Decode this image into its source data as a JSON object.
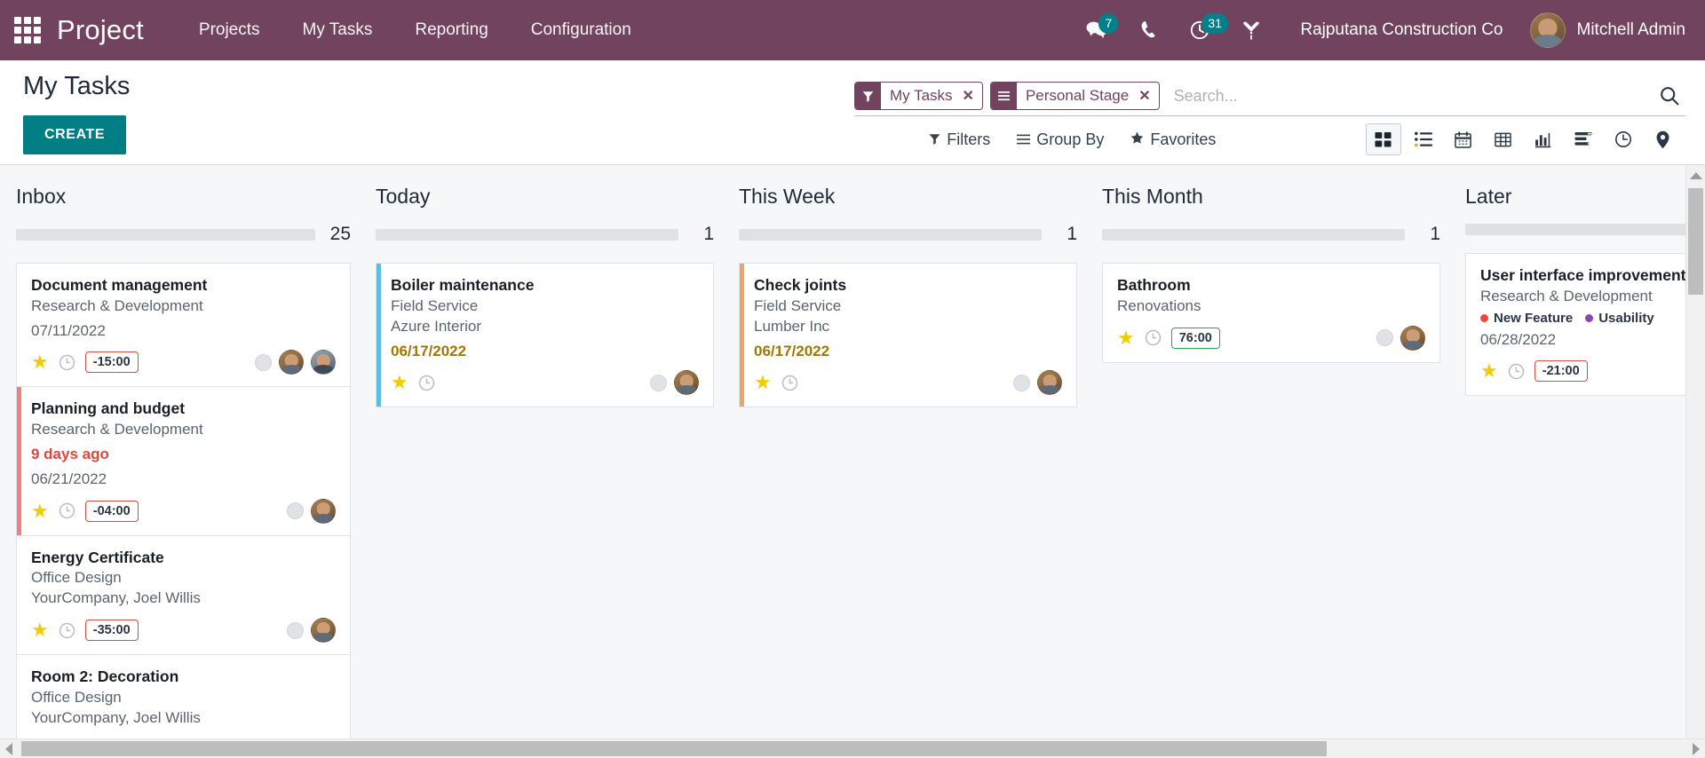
{
  "navbar": {
    "apps_icon": "apps-grid-icon",
    "brand": "Project",
    "menu": [
      {
        "label": "Projects"
      },
      {
        "label": "My Tasks"
      },
      {
        "label": "Reporting"
      },
      {
        "label": "Configuration"
      }
    ],
    "systray": {
      "messages_icon": "messages-icon",
      "messages_count": "7",
      "phone_icon": "phone-icon",
      "activities_icon": "activity-clock-icon",
      "activities_count": "31",
      "debug_icon": "wrench-tools-icon"
    },
    "company": "Rajputana Construction Co",
    "user": "Mitchell Admin",
    "accent_color": "#71435f",
    "badge_color": "#00808a"
  },
  "control_panel": {
    "title": "My Tasks",
    "create_label": "CREATE",
    "create_color": "#017e84",
    "search": {
      "placeholder": "Search...",
      "value": "",
      "facets": [
        {
          "icon": "filter-funnel-icon",
          "label": "My Tasks",
          "close": "✕"
        },
        {
          "icon": "group-by-list-icon",
          "label": "Personal Stage",
          "close": "✕"
        }
      ],
      "search_icon": "search-magnifier-icon"
    },
    "dropdowns": [
      {
        "icon": "filter-funnel-icon",
        "label": "Filters"
      },
      {
        "icon": "group-by-list-icon",
        "label": "Group By"
      },
      {
        "icon": "star-icon",
        "label": "Favorites"
      }
    ],
    "views": [
      {
        "name": "kanban-view",
        "active": true
      },
      {
        "name": "list-view",
        "active": false
      },
      {
        "name": "calendar-view",
        "active": false
      },
      {
        "name": "pivot-view",
        "active": false
      },
      {
        "name": "graph-view",
        "active": false
      },
      {
        "name": "gantt-view",
        "active": false
      },
      {
        "name": "activity-view",
        "active": false
      },
      {
        "name": "map-view",
        "active": false
      }
    ]
  },
  "kanban": {
    "columns": [
      {
        "title": "Inbox",
        "count": "25",
        "progress": [
          {
            "color": "#28a745",
            "percent": 8
          }
        ],
        "cards": [
          {
            "title": "Document management",
            "project": "Research & Development",
            "customer": "",
            "tags": [],
            "relative_date": "",
            "date": "07/11/2022",
            "date_state": "normal",
            "star": "★",
            "clock_icon": "clock-icon",
            "time_badge": "-15:00",
            "time_state": "negative",
            "circle": "status-circle",
            "avatars": [
              "brown",
              "gray"
            ],
            "stripe": ""
          },
          {
            "title": "Planning and budget",
            "project": "Research & Development",
            "customer": "",
            "tags": [],
            "relative_date": "9 days ago",
            "date": "06/21/2022",
            "date_state": "overdue",
            "star": "★",
            "clock_icon": "clock-icon",
            "time_badge": "-04:00",
            "time_state": "negative",
            "circle": "status-circle",
            "avatars": [
              "brown"
            ],
            "stripe": "#f08080"
          },
          {
            "title": "Energy Certificate",
            "project": "Office Design",
            "customer": "YourCompany, Joel Willis",
            "tags": [],
            "relative_date": "",
            "date": "",
            "date_state": "normal",
            "star": "★",
            "clock_icon": "clock-icon",
            "time_badge": "-35:00",
            "time_state": "negative",
            "circle": "status-circle",
            "avatars": [
              "brown"
            ],
            "stripe": ""
          },
          {
            "title": "Room 2: Decoration",
            "project": "Office Design",
            "customer": "YourCompany, Joel Willis",
            "tags": [],
            "relative_date": "",
            "date": "",
            "date_state": "normal",
            "star": "",
            "clock_icon": "",
            "time_badge": "",
            "time_state": "",
            "circle": "",
            "avatars": [],
            "stripe": ""
          }
        ]
      },
      {
        "title": "Today",
        "count": "1",
        "progress": [],
        "cards": [
          {
            "title": "Boiler maintenance",
            "project": "Field Service",
            "customer": "Azure Interior",
            "tags": [],
            "relative_date": "",
            "date": "06/17/2022",
            "date_state": "due",
            "star": "★",
            "clock_icon": "clock-icon",
            "time_badge": "",
            "time_state": "",
            "circle": "status-circle",
            "avatars": [
              "brown"
            ],
            "stripe": "#5bc0de"
          }
        ]
      },
      {
        "title": "This Week",
        "count": "1",
        "progress": [],
        "cards": [
          {
            "title": "Check joints",
            "project": "Field Service",
            "customer": "Lumber Inc",
            "tags": [],
            "relative_date": "",
            "date": "06/17/2022",
            "date_state": "due",
            "star": "★",
            "clock_icon": "clock-icon",
            "time_badge": "",
            "time_state": "",
            "circle": "status-circle",
            "avatars": [
              "brown"
            ],
            "stripe": "#f0a460"
          }
        ]
      },
      {
        "title": "This Month",
        "count": "1",
        "progress": [],
        "cards": [
          {
            "title": "Bathroom",
            "project": "Renovations",
            "customer": "",
            "tags": [],
            "relative_date": "",
            "date": "",
            "date_state": "normal",
            "star": "★",
            "clock_icon": "clock-icon",
            "time_badge": "76:00",
            "time_state": "positive",
            "circle": "status-circle",
            "avatars": [
              "brown"
            ],
            "stripe": ""
          }
        ]
      },
      {
        "title": "Later",
        "count": "",
        "progress": [],
        "cards": [
          {
            "title": "User interface improvements",
            "project": "Research & Development",
            "customer": "",
            "tags": [
              {
                "label": "New Feature",
                "color": "#f0453a"
              },
              {
                "label": "Usability",
                "color": "#8e44ad"
              }
            ],
            "relative_date": "",
            "date": "06/28/2022",
            "date_state": "normal",
            "star": "★",
            "clock_icon": "clock-icon",
            "time_badge": "-21:00",
            "time_state": "negative",
            "circle": "",
            "avatars": [],
            "stripe": ""
          }
        ]
      }
    ]
  }
}
